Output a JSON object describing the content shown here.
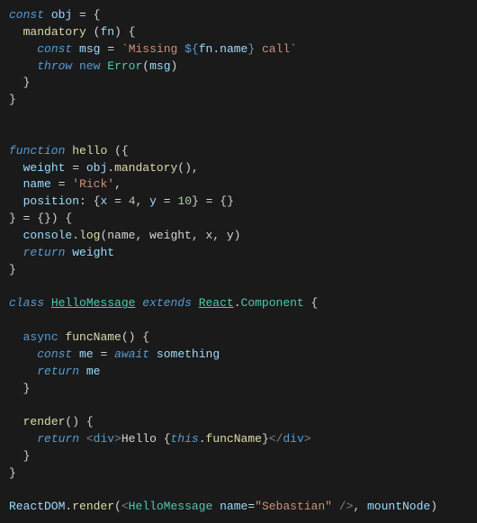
{
  "code": {
    "l1": {
      "kw": "const",
      "var": "obj",
      "op": "=",
      "brace": "{"
    },
    "l2": {
      "fn": "mandatory",
      "param": "fn",
      "brace": "{"
    },
    "l3": {
      "kw": "const",
      "var": "msg",
      "op": "=",
      "s1": "`Missing ",
      "s2": "${",
      "v2": "fn",
      "dot": ".",
      "v3": "name",
      "s3": "}",
      "s4": " call`"
    },
    "l4": {
      "kw1": "throw",
      "kw2": "new",
      "cls": "Error",
      "arg": "msg"
    },
    "l5": {
      "brace": "}"
    },
    "l6": {
      "brace": "}"
    },
    "l8": {
      "kw": "function",
      "fn": "hello",
      "open": "({"
    },
    "l9": {
      "var": "weight",
      "op": "=",
      "obj": "obj",
      "dot": ".",
      "fn": "mandatory",
      "call": "(),"
    },
    "l10": {
      "var": "name",
      "op": "=",
      "str": "'Rick'",
      "comma": ","
    },
    "l11": {
      "var": "position",
      "colon": ":",
      "b1": "{",
      "x": "x",
      "eq1": "=",
      "n1": "4",
      "c1": ",",
      "y": "y",
      "eq2": "=",
      "n2": "10",
      "b2": "}",
      "eq3": "=",
      "b3": "{}"
    },
    "l12": {
      "close": "} = {}) {"
    },
    "l13": {
      "obj": "console",
      "dot": ".",
      "fn": "log",
      "args": "(name, weight, x, y)"
    },
    "l14": {
      "kw": "return",
      "var": "weight"
    },
    "l15": {
      "brace": "}"
    },
    "l17": {
      "kw1": "class",
      "cls": "HelloMessage",
      "kw2": "extends",
      "sup1": "React",
      "dot": ".",
      "sup2": "Component",
      "brace": "{"
    },
    "l19": {
      "kw": "async",
      "fn": "funcName",
      "sig": "() {"
    },
    "l20": {
      "kw1": "const",
      "var": "me",
      "op": "=",
      "kw2": "await",
      "val": "something"
    },
    "l21": {
      "kw": "return",
      "var": "me"
    },
    "l22": {
      "brace": "}"
    },
    "l24": {
      "fn": "render",
      "sig": "() {"
    },
    "l25": {
      "kw": "return",
      "o1": "<",
      "tag1": "div",
      "o2": ">",
      "txt1": "Hello ",
      "b1": "{",
      "this": "this",
      "dot": ".",
      "fn": "funcName",
      "b2": "}",
      "c1": "</",
      "tag2": "div",
      "c2": ">"
    },
    "l26": {
      "brace": "}"
    },
    "l27": {
      "brace": "}"
    },
    "l29": {
      "obj": "ReactDOM",
      "dot": ".",
      "fn": "render",
      "p1": "(",
      "o1": "<",
      "cmp": "HelloMessage",
      "attr": "name",
      "eq": "=",
      "val": "\"Sebastian\"",
      "close": " />",
      "c1": ",",
      "arg": "mountNode",
      "p2": ")"
    }
  }
}
